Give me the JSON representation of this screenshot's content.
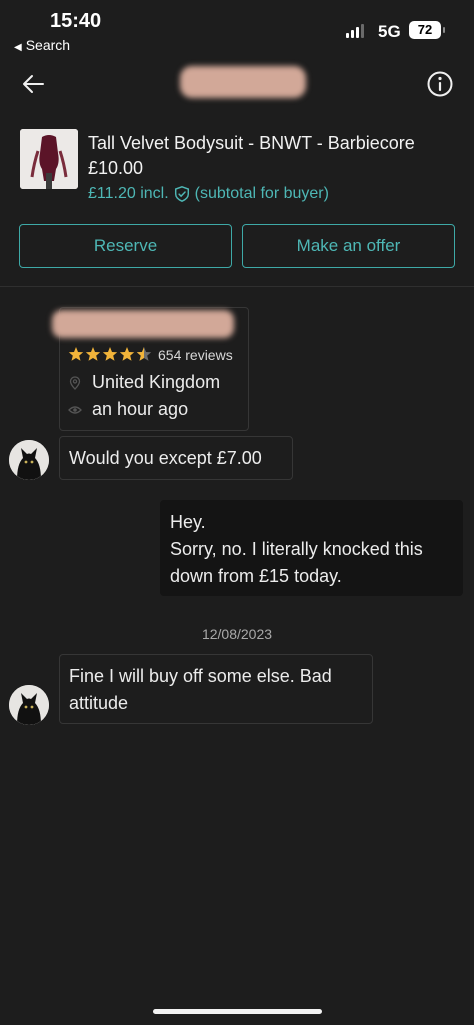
{
  "status_bar": {
    "time": "15:40",
    "back_label": "Search",
    "network": "5G",
    "battery": "72"
  },
  "header": {
    "back_icon": "arrow-left-icon",
    "info_icon": "info-icon"
  },
  "product": {
    "title": "Tall Velvet Bodysuit - BNWT - Barbiecore",
    "price": "£10.00",
    "incl_price": "£11.20 incl.",
    "incl_note": "(subtotal for buyer)",
    "shield_icon": "shield-check-icon"
  },
  "actions": {
    "reserve": "Reserve",
    "offer": "Make an offer"
  },
  "profile": {
    "rating": 4.5,
    "reviews": "654 reviews",
    "location": "United Kingdom",
    "last_seen": "an hour ago"
  },
  "messages": [
    {
      "direction": "in",
      "lines": [
        "Would you except £7.00"
      ]
    },
    {
      "direction": "out",
      "lines": [
        "Hey.",
        "Sorry, no. I literally knocked this",
        "down from £15 today."
      ]
    },
    {
      "direction": "in",
      "lines": [
        "Fine I will buy off some else. Bad",
        "attitude"
      ]
    }
  ],
  "date_separator": "12/08/2023",
  "colors": {
    "accent": "#4eb7b5",
    "background": "#1d1d1d",
    "star": "#f2b43a"
  }
}
